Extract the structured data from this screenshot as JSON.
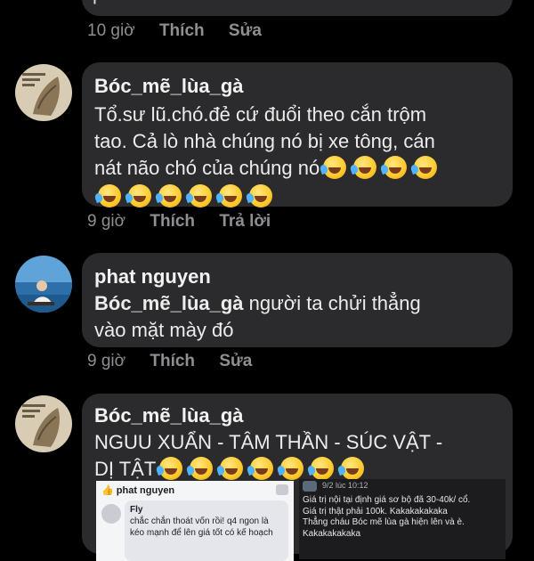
{
  "top_partial": {
    "text_fragment": "phet",
    "time": "10 giờ",
    "like_label": "Thích",
    "action_label": "Sửa"
  },
  "comments": [
    {
      "author": "Bóc_mẽ_lùa_gà",
      "line1": "Tổ.sư lũ.chó.đẻ cứ đuổi theo cắn trộm",
      "line2": "tao. Cả lò nhà chúng nó bị xe tông, cán",
      "line3": "nát não chó  của chúng nó",
      "time": "9 giờ",
      "like_label": "Thích",
      "action_label": "Trả lời",
      "emoji": "rolling-on-floor-laughing"
    },
    {
      "author": "phat nguyen",
      "mention": "Bóc_mẽ_lùa_gà",
      "line1": " người ta chửi thẳng",
      "line2": "vào mặt mày đó",
      "time": "9 giờ",
      "like_label": "Thích",
      "action_label": "Sửa"
    },
    {
      "author": "Bóc_mẽ_lùa_gà",
      "line1": "NGUU XUẨN - TÂM THẦN  - SÚC VẬT -",
      "line2": "DỊ TẬT",
      "emoji": "rolling-on-floor-laughing"
    }
  ],
  "screenshot_left": {
    "author": "phat nguyen",
    "reply_author": "Fly",
    "reply_line1": "chắc chắn thoát vốn rồi! q4 ngon là",
    "reply_line2": "kéo mạnh để lên giá tốt có kế hoạch"
  },
  "screenshot_right": {
    "date": "9/2 lúc 10:12",
    "line1": "Giá trị nội tại định giá sơ bộ đã 30-40k/ cổ.",
    "line2": "Giá trị thật phải 100k. Kakakakakaka",
    "line3": "Thẳng cháu Bóc mẽ lùa gà hiện lên và è.",
    "line4": "Kakakakakaka"
  }
}
